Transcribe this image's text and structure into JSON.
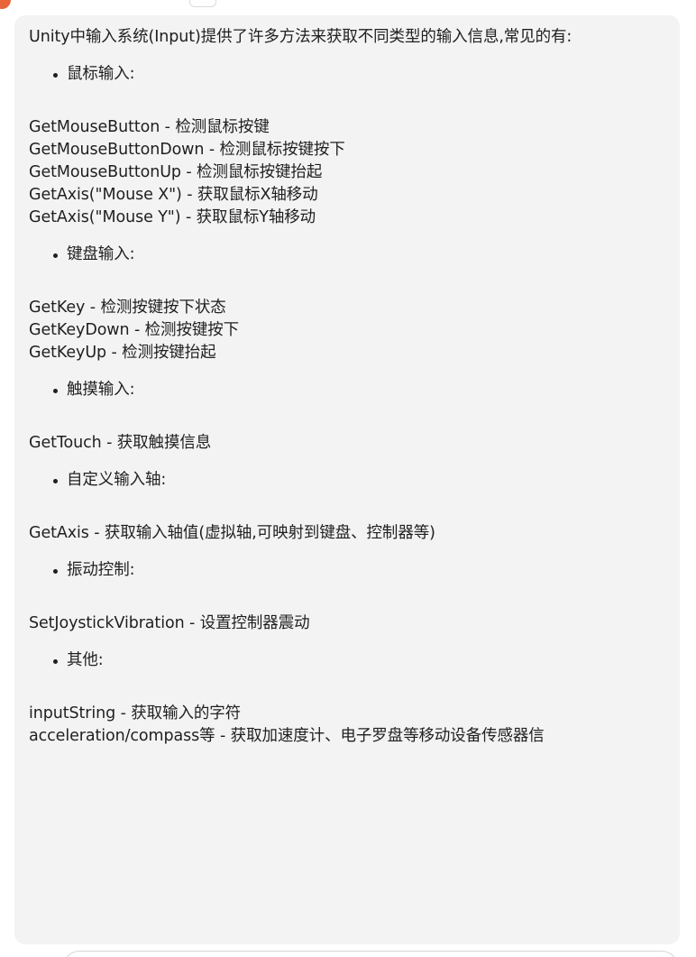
{
  "intro": "Unity中输入系统(Input)提供了许多方法来获取不同类型的输入信息,常见的有:",
  "sections": [
    {
      "heading": "鼠标输入:",
      "lines": [
        "GetMouseButton - 检测鼠标按键",
        "GetMouseButtonDown - 检测鼠标按键按下",
        "GetMouseButtonUp - 检测鼠标按键抬起",
        "GetAxis(\"Mouse X\") - 获取鼠标X轴移动",
        "GetAxis(\"Mouse Y\") - 获取鼠标Y轴移动"
      ]
    },
    {
      "heading": "键盘输入:",
      "lines": [
        "GetKey - 检测按键按下状态",
        "GetKeyDown - 检测按键按下",
        "GetKeyUp - 检测按键抬起"
      ]
    },
    {
      "heading": "触摸输入:",
      "lines": [
        "GetTouch - 获取触摸信息"
      ]
    },
    {
      "heading": "自定义输入轴:",
      "lines": [
        "GetAxis - 获取输入轴值(虚拟轴,可映射到键盘、控制器等)"
      ]
    },
    {
      "heading": "振动控制:",
      "lines": [
        "SetJoystickVibration - 设置控制器震动"
      ]
    },
    {
      "heading": "其他:",
      "lines": [
        "inputString - 获取输入的字符",
        "acceleration/compass等 - 获取加速度计、电子罗盘等移动设备传感器信"
      ]
    }
  ],
  "colors": {
    "bubble_bg": "#f3f3f3",
    "text": "#1f1f1f",
    "avatar": "#e8643a"
  }
}
